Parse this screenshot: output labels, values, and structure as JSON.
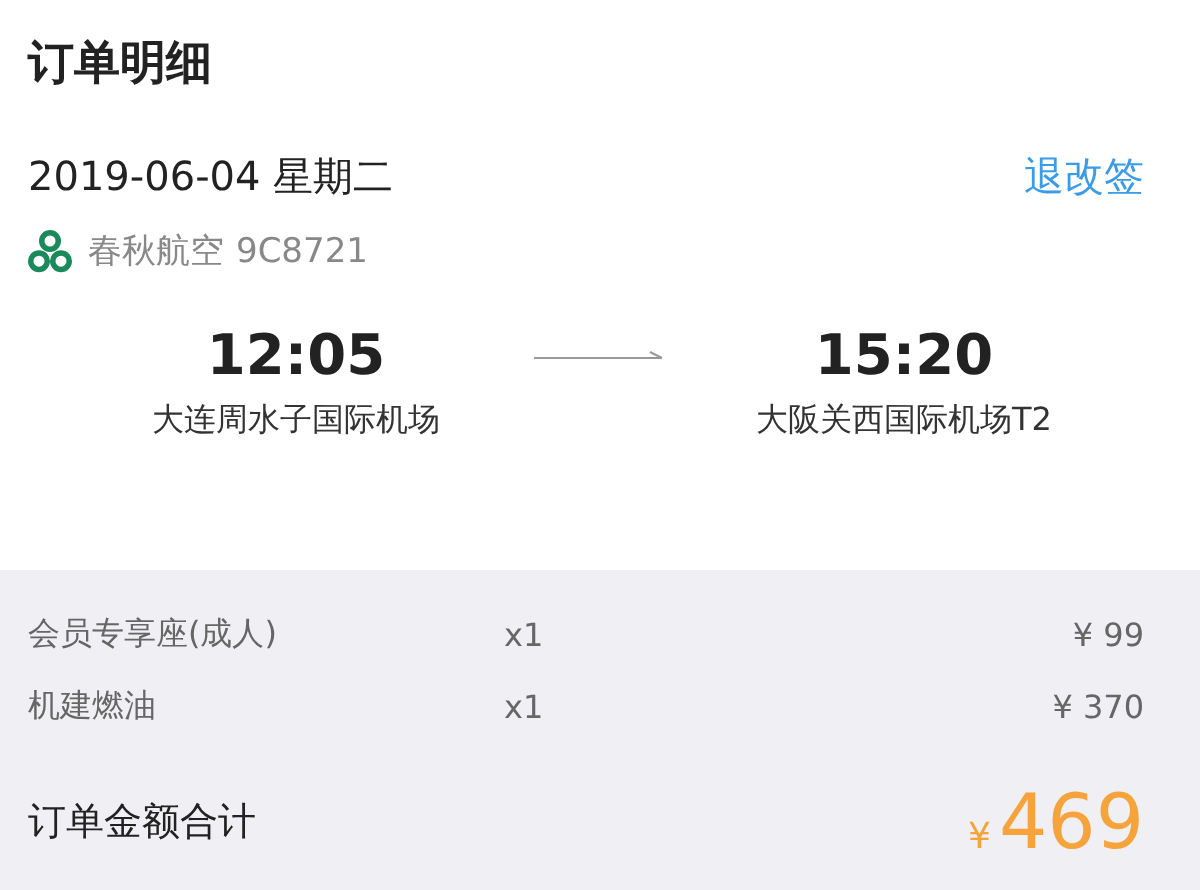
{
  "title": "订单明细",
  "flight": {
    "date": "2019-06-04 星期二",
    "change_link": "退改签",
    "airline": "春秋航空",
    "flight_no": "9C8721",
    "depart_time": "12:05",
    "arrive_time": "15:20",
    "depart_airport": "大连周水子国际机场",
    "arrive_airport": "大阪关西国际机场T2"
  },
  "items": [
    {
      "name": "会员专享座(成人)",
      "qty": "x1",
      "price": "¥ 99"
    },
    {
      "name": "机建燃油",
      "qty": "x1",
      "price": "¥ 370"
    }
  ],
  "total": {
    "label": "订单金额合计",
    "currency": "¥",
    "amount": "469"
  }
}
